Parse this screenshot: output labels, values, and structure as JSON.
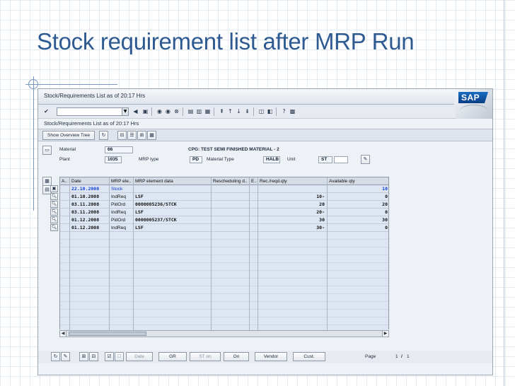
{
  "slide": {
    "title": "Stock requirement list after MRP Run"
  },
  "window": {
    "title": "Stock/Requirements List as of 20:17 Hrs",
    "subtitle": "Stock/Requirements List as of 20:17 Hrs",
    "logo": "SAP"
  },
  "appbar": {
    "overview_button": "Show Overview Tree"
  },
  "header": {
    "material_label": "Material",
    "material_value": "66",
    "material_desc": "CPG: TEST SEMI FINISHED MATERIAL - 2",
    "plant_label": "Plant",
    "plant_value": "1035",
    "mrp_type_label": "MRP type",
    "mrp_type_value": "PD",
    "material_type_label": "Material Type",
    "material_type_value": "HALB",
    "unit_label": "Unit",
    "unit_value": "ST"
  },
  "table": {
    "columns": [
      "A..",
      "Date",
      "MRP ele..",
      "MRP element data",
      "Rescheduling d..",
      "E..",
      "Rec./reqd.qty",
      "Available qty"
    ],
    "rows": [
      {
        "date": "22.10.2008",
        "element": "Stock",
        "data": "",
        "resched": "",
        "e": "",
        "qty": "",
        "avail": "10",
        "stock": true
      },
      {
        "date": "01.10.2008",
        "element": "IndReq",
        "data": "LSF",
        "resched": "",
        "e": "",
        "qty": "10-",
        "avail": "0",
        "stock": false
      },
      {
        "date": "03.11.2008",
        "element": "PldOrd",
        "data": "0000005236/STCK",
        "resched": "",
        "e": "",
        "qty": "20",
        "avail": "20",
        "stock": false
      },
      {
        "date": "03.11.2008",
        "element": "IndReq",
        "data": "LSF",
        "resched": "",
        "e": "",
        "qty": "20-",
        "avail": "0",
        "stock": false
      },
      {
        "date": "01.12.2008",
        "element": "PldOrd",
        "data": "0000005237/STCK",
        "resched": "",
        "e": "",
        "qty": "30",
        "avail": "30",
        "stock": false
      },
      {
        "date": "01.12.2008",
        "element": "IndReq",
        "data": "LSF",
        "resched": "",
        "e": "",
        "qty": "30-",
        "avail": "0",
        "stock": false
      }
    ]
  },
  "footer": {
    "date_button": "Date",
    "gr_button": "GR",
    "st_on_button": "ST on",
    "on_button": "On",
    "vendor_button": "Vendor",
    "cust_button": "Cust.",
    "page_label": "Page",
    "page_current": "1",
    "page_sep": "/",
    "page_total": "1"
  },
  "icons": {
    "enter": "check-icon",
    "save": "save-icon",
    "back": "back-icon",
    "exit": "exit-icon",
    "cancel": "cancel-icon",
    "help": "help-icon",
    "element_detail": "magnifier-icon"
  }
}
